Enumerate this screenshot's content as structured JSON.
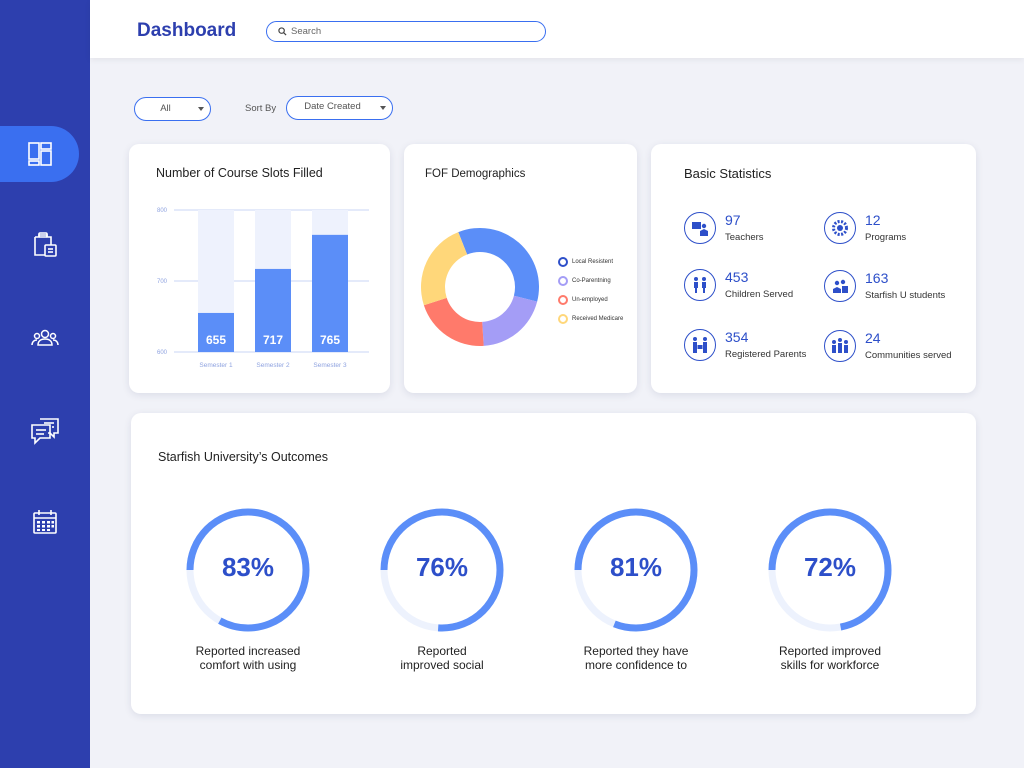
{
  "header": {
    "title": "Dashboard",
    "search_placeholder": "Search"
  },
  "sidebar": {
    "items": [
      {
        "name": "dashboard",
        "icon": "dashboard-icon",
        "active": true
      },
      {
        "name": "clipboard",
        "icon": "clipboard-icon",
        "active": false
      },
      {
        "name": "users",
        "icon": "users-icon",
        "active": false
      },
      {
        "name": "messages",
        "icon": "chat-icon",
        "active": false
      },
      {
        "name": "calendar",
        "icon": "calendar-icon",
        "active": false
      }
    ]
  },
  "filters": {
    "category_value": "All",
    "sort_label": "Sort By",
    "sort_value": "Date Created"
  },
  "course_slots": {
    "title": "Number of Course Slots Filled"
  },
  "demographics": {
    "title": "FOF Demographics",
    "legend": [
      {
        "label": "Local Resistent",
        "color": "#2d4fc9"
      },
      {
        "label": "Co-Parentning",
        "color": "#a49df6"
      },
      {
        "label": "Un-employed",
        "color": "#ff7a6b"
      },
      {
        "label": "Received Medicare",
        "color": "#ffd77a"
      }
    ]
  },
  "basic_stats": {
    "title": "Basic Statistics",
    "items": [
      {
        "value": "97",
        "label": "Teachers",
        "icon": "teacher-icon"
      },
      {
        "value": "12",
        "label": "Programs",
        "icon": "programs-gear-icon"
      },
      {
        "value": "453",
        "label": "Children Served",
        "icon": "children-icon"
      },
      {
        "value": "163",
        "label": "Starfish U students",
        "icon": "students-icon"
      },
      {
        "value": "354",
        "label": "Registered Parents",
        "icon": "parents-icon"
      },
      {
        "value": "24",
        "label": "Communities served",
        "icon": "community-icon"
      }
    ]
  },
  "outcomes": {
    "title": "Starfish University’s Outcomes",
    "items": [
      {
        "percent": "83%",
        "value": 83,
        "line1": "Reported increased",
        "line2": "comfort with using"
      },
      {
        "percent": "76%",
        "value": 76,
        "line1": "Reported",
        "line2": "improved social"
      },
      {
        "percent": "81%",
        "value": 81,
        "line1": "Reported they have",
        "line2": "more confidence to"
      },
      {
        "percent": "72%",
        "value": 72,
        "line1": "Reported improved",
        "line2": "skills for workforce"
      }
    ]
  },
  "chart_data": [
    {
      "type": "bar",
      "title": "Number of Course Slots Filled",
      "categories": [
        "Semester 1",
        "Semester 2",
        "Semester 3"
      ],
      "values": [
        655,
        717,
        765
      ],
      "ylim": [
        600,
        800
      ],
      "yticks": [
        "800",
        "700",
        "600"
      ],
      "grid": true,
      "bar_color": "#5b8ef8",
      "track_color": "#eef2fd"
    },
    {
      "type": "pie",
      "title": "FOF Demographics",
      "donut": true,
      "labels": [
        "Local Resistent",
        "Co-Parentning",
        "Un-employed",
        "Received Medicare"
      ],
      "values": [
        35,
        20,
        21,
        24
      ],
      "colors": [
        "#5b8ef8",
        "#a49df6",
        "#ff7a6b",
        "#ffd77a"
      ]
    }
  ]
}
